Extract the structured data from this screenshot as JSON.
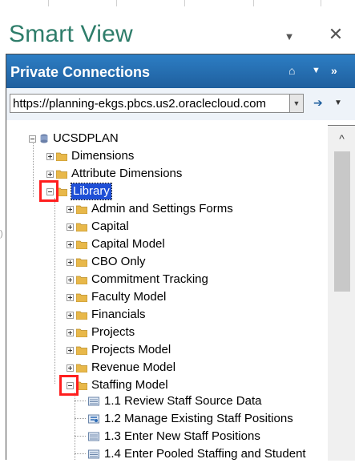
{
  "pane": {
    "title": "Smart View"
  },
  "panel": {
    "header": "Private Connections",
    "url": "https://planning-ekgs.pbcs.us2.oraclecloud.com"
  },
  "tree": {
    "root": "UCSDPLAN",
    "dimensions": "Dimensions",
    "attribute_dimensions": "Attribute Dimensions",
    "library": "Library",
    "library_children": [
      "Admin and Settings Forms",
      "Capital",
      "Capital Model",
      "CBO Only",
      "Commitment Tracking",
      "Faculty Model",
      "Financials",
      "Projects",
      "Projects Model",
      "Revenue Model",
      "Staffing Model"
    ],
    "staffing_children": [
      "1.1 Review Staff Source Data",
      "1.2 Manage Existing Staff Positions",
      "1.3 Enter New Staff Positions",
      "1.4 Enter Pooled Staffing and Student"
    ]
  },
  "colors": {
    "title": "#2e7d6a",
    "header": "#1f5f9e",
    "selection": "#1f4fd6",
    "highlight": "#ff1e1e",
    "folder": "#e8b84a"
  },
  "icons": [
    "home-icon",
    "dropdown-icon",
    "close-icon",
    "more-icon",
    "arrow-right-icon",
    "folder-icon",
    "form-icon",
    "database-icon"
  ]
}
